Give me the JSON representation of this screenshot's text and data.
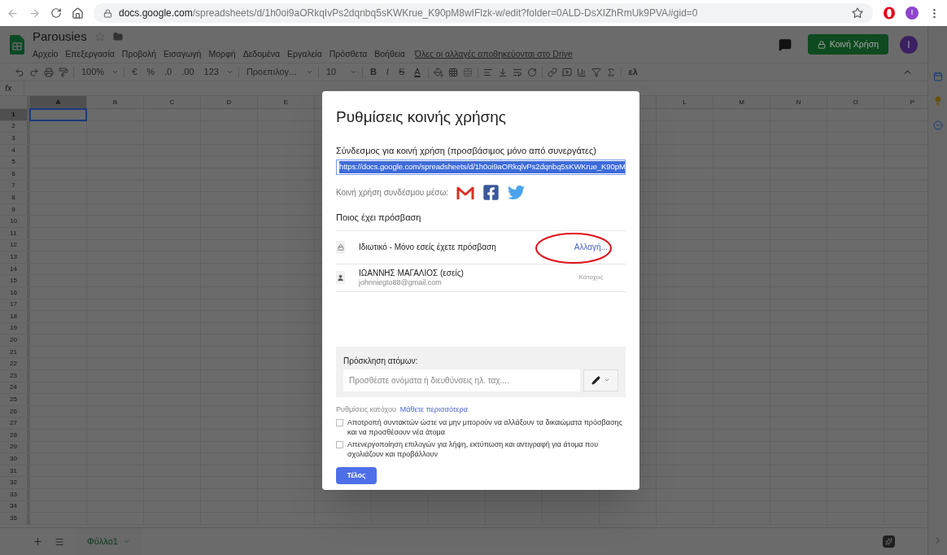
{
  "browser": {
    "url_domain": "docs.google.com",
    "url_path": "/spreadsheets/d/1h0oi9aORkqIvPs2dqnbq5sKWKrue_K90pM8wIFlzk-w/edit?folder=0ALD-DsXIZhRmUk9PVA#gid=0",
    "bookmarked": false,
    "profile_initial": "I"
  },
  "document": {
    "title": "Parousies",
    "starred": false,
    "save_status": "Όλες οι αλλαγές αποθηκεύονται στο Drive",
    "share_button": "Κοινή Χρήση",
    "avatar_initial": "I"
  },
  "menu": [
    "Αρχείο",
    "Επεξεργασία",
    "Προβολή",
    "Εισαγωγή",
    "Μορφή",
    "Δεδομένα",
    "Εργαλεία",
    "Πρόσθετα",
    "Βοήθεια"
  ],
  "toolbar": {
    "zoom": "100%",
    "currency": "€",
    "percent": "%",
    "decimal_less": ".0",
    "decimal_more": ".00",
    "number_format": "123",
    "font": "Προεπιλογ...",
    "font_size": "10",
    "bold": "B",
    "italic": "I",
    "strikethrough": "S",
    "text_color": "A",
    "input_tools": "ελ"
  },
  "formula_bar": {
    "label": "fx"
  },
  "columns": [
    {
      "label": "A",
      "selected": true
    },
    {
      "label": "B",
      "selected": false
    },
    {
      "label": "C",
      "selected": false
    },
    {
      "label": "D",
      "selected": false
    },
    {
      "label": "E",
      "selected": false
    },
    {
      "label": "L",
      "selected": false
    },
    {
      "label": "M",
      "selected": false
    },
    {
      "label": "N",
      "selected": false
    },
    {
      "label": "O",
      "selected": false
    },
    {
      "label": "P",
      "selected": false
    }
  ],
  "rows": [
    {
      "label": "1",
      "selected": true
    },
    {
      "label": "2",
      "selected": false
    },
    {
      "label": "3",
      "selected": false
    },
    {
      "label": "4",
      "selected": false
    },
    {
      "label": "5",
      "selected": false
    },
    {
      "label": "6",
      "selected": false
    },
    {
      "label": "7",
      "selected": false
    },
    {
      "label": "8",
      "selected": false
    },
    {
      "label": "9",
      "selected": false
    },
    {
      "label": "10",
      "selected": false
    },
    {
      "label": "11",
      "selected": false
    },
    {
      "label": "12",
      "selected": false
    },
    {
      "label": "13",
      "selected": false
    },
    {
      "label": "14",
      "selected": false
    },
    {
      "label": "15",
      "selected": false
    },
    {
      "label": "16",
      "selected": false
    },
    {
      "label": "17",
      "selected": false
    },
    {
      "label": "18",
      "selected": false
    },
    {
      "label": "19",
      "selected": false
    },
    {
      "label": "20",
      "selected": false
    },
    {
      "label": "21",
      "selected": false
    },
    {
      "label": "22",
      "selected": false
    },
    {
      "label": "23",
      "selected": false
    },
    {
      "label": "24",
      "selected": false
    },
    {
      "label": "25",
      "selected": false
    },
    {
      "label": "26",
      "selected": false
    },
    {
      "label": "27",
      "selected": false
    },
    {
      "label": "28",
      "selected": false
    },
    {
      "label": "29",
      "selected": false
    },
    {
      "label": "30",
      "selected": false
    },
    {
      "label": "31",
      "selected": false
    },
    {
      "label": "32",
      "selected": false
    },
    {
      "label": "33",
      "selected": false
    },
    {
      "label": "34",
      "selected": false
    },
    {
      "label": "35",
      "selected": false
    }
  ],
  "sheet_tabs": [
    {
      "label": "Φύλλο1",
      "selected": true
    }
  ],
  "dialog": {
    "title": "Ρυθμίσεις κοινής χρήσης",
    "link_label": "Σύνδεσμος για κοινή χρήση (προσβάσιμος μόνο από συνεργάτες)",
    "link_value": "https://docs.google.com/spreadsheets/d/1h0oi9aORkqlvPs2dqnbq5sKWKrue_K90pM",
    "link_selected": true,
    "share_via_label": "Κοινή χρήση συνδέσμου μέσω:",
    "access_heading": "Ποιος έχει πρόσβαση",
    "general_access": {
      "text": "Ιδιωτικό - Μόνο εσείς έχετε πρόσβαση",
      "change_link": "Αλλαγή...",
      "circled": true
    },
    "people": [
      {
        "name": "ΙΩΑΝΝΗΣ ΜΑΓΑΛΙΟΣ (εσείς)",
        "email": "johnniegto88@gmail.com",
        "role": "Κάτοχος"
      }
    ],
    "invite": {
      "label": "Πρόσκληση ατόμων:",
      "placeholder": "Προσθέστε ονόματα ή διευθύνσεις ηλ. ταχ...."
    },
    "owner_settings": {
      "label": "Ρυθμίσεις κατόχου",
      "learn_more": "Μάθετε περισσότερα"
    },
    "options": [
      {
        "text": "Αποτροπή συντακτών ώστε να μην μπορούν να αλλάξουν τα δικαιώματα πρόσβασης και να προσθέσουν νέα άτομα",
        "checked": false
      },
      {
        "text": "Απενεργοποίηση επιλογών για λήψη, εκτύπωση και αντιγραφή για άτομα που σχολιάζουν και προβάλλουν",
        "checked": false
      }
    ],
    "done_button": "Τέλος"
  }
}
